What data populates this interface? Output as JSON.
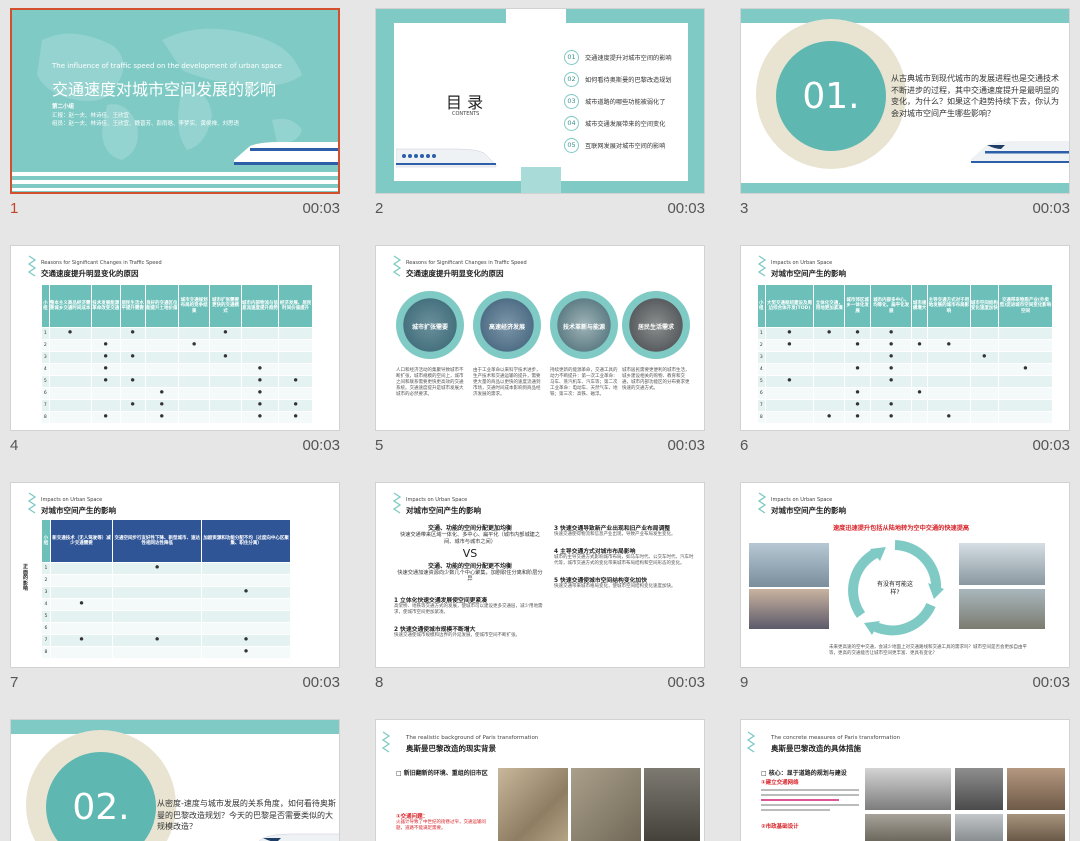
{
  "slides": [
    {
      "number": "1",
      "duration": "00:03",
      "en_title": "The influence of traffic speed on the development of urban space",
      "cn_title": "交通速度对城市空间发展的影响",
      "group": "第二小组",
      "reporters": "汇报：赵一夫、林诗佳、王欣宜",
      "members": "组员：赵一夫、林诗佳、王欣宜、魏晋芳、彭雨晗、李梦实、黄侯禅、刘思语"
    },
    {
      "number": "2",
      "duration": "00:03",
      "toc_title": "目 录",
      "toc_sub": "CONTENTS",
      "items": [
        {
          "n": "01",
          "t": "交通速度提升对城市空间的影响"
        },
        {
          "n": "02",
          "t": "如何看待奥斯曼的巴黎改造规划"
        },
        {
          "n": "03",
          "t": "城市道路的哪些功能被弱化了"
        },
        {
          "n": "04",
          "t": "城市交通发展带来的空间变化"
        },
        {
          "n": "05",
          "t": "互联网发展对城市空间的影响"
        }
      ]
    },
    {
      "number": "3",
      "duration": "00:03",
      "big": "01.",
      "text": "从古典城市到现代城市的发展进程也是交通技术不断进步的过程，其中交通速度提升是最明显的变化，为什么？如果这个趋势持续下去，你认为会对城市空间产生哪些影响？"
    },
    {
      "number": "4",
      "duration": "00:03",
      "en": "Reasons for Significant Changes in Traffic Speed",
      "cn": "交通速度提升明显变化的原因",
      "headers": [
        "小组",
        "整本主义商品经济需要城乡交通时间成本",
        "技术发展能源革命改变交通",
        "居民生活水平提升需要",
        "良好的交通区位能提升土地价值",
        "城市交通规划布局的竞争结果",
        "城市扩张需要更快的交通模式",
        "城市内部物流与信息流速度提升趋势",
        "经济发展、居民时间价值提升"
      ],
      "rows": [
        [
          "1",
          "●",
          "",
          "●",
          "",
          "",
          "●",
          "",
          ""
        ],
        [
          "2",
          "",
          "●",
          "",
          "",
          "●",
          "",
          "",
          ""
        ],
        [
          "3",
          "",
          "●",
          "●",
          "",
          "",
          "●",
          "",
          ""
        ],
        [
          "4",
          "",
          "●",
          "",
          "",
          "",
          "",
          "●",
          ""
        ],
        [
          "5",
          "",
          "●",
          "●",
          "",
          "",
          "",
          "●",
          "●"
        ],
        [
          "6",
          "",
          "",
          "",
          "●",
          "",
          "",
          "●",
          ""
        ],
        [
          "7",
          "",
          "",
          "●",
          "●",
          "",
          "",
          "●",
          "●"
        ],
        [
          "8",
          "",
          "●",
          "",
          "●",
          "",
          "",
          "●",
          "●"
        ]
      ]
    },
    {
      "number": "5",
      "duration": "00:03",
      "en": "Reasons for Significant Changes in Traffic Speed",
      "cn": "交通速度提升明显变化的原因",
      "circles": [
        "城市扩张需要",
        "高速经济发展",
        "技术革新与能源",
        "居民生活需求"
      ],
      "texts": [
        "人口和经济活动的集聚导致城市不断扩张，城市规模的空间上，城市之间和联系需要更快更高效的交通系统。交通速度提升是城市发展大城市的必然要求。",
        "由于工业革命以来科学技术进步，生产技术和交通运输的提升，需要更大量的商品以更快的速度流通到市场，交通时间成本影响到商品经济发展的需求。",
        "持续更新的能源革命，交通工具的动力不断提升：第一次工业革命：马车、蒸汽机车、汽车等；第二次工业革命：电动车、天然气车、地铁；第三次：高铁、磁浮。",
        "城市居民需要更便利的城市生活，城乡建设相关的购物、教育和交通，城市内部功能区的分布要求更快速的交通方式。"
      ]
    },
    {
      "number": "6",
      "duration": "00:03",
      "en": "Impacts on Urban Space",
      "cn": "对城市空间产生的影响",
      "headers": [
        "小组",
        "大型交通枢纽建设及周边综合体开发(TOD)",
        "立体化交通，用地更加紧凑",
        "城市郊区城乡一体化发展",
        "城市内部多中心，均等化，扁平化发展",
        "城市规模增大",
        "主导交通方式对于用地发展的城市布局影响",
        "城市空间结构变化速度加快",
        "交通带来物质产业(外卖型)促进城市空间变化影响空间"
      ],
      "rows": [
        [
          "1",
          "●",
          "●",
          "●",
          "●",
          "",
          "",
          "",
          ""
        ],
        [
          "2",
          "●",
          "",
          "●",
          "●",
          "●",
          "●",
          "",
          ""
        ],
        [
          "3",
          "",
          "",
          "",
          "●",
          "",
          "",
          "●",
          ""
        ],
        [
          "4",
          "",
          "",
          "●",
          "●",
          "",
          "",
          "",
          "●"
        ],
        [
          "5",
          "●",
          "",
          "",
          "●",
          "",
          "",
          "",
          ""
        ],
        [
          "6",
          "",
          "",
          "●",
          "",
          "●",
          "",
          "",
          ""
        ],
        [
          "7",
          "",
          "",
          "●",
          "●",
          "",
          "",
          "",
          ""
        ],
        [
          "8",
          "",
          "●",
          "●",
          "●",
          "",
          "●",
          "",
          ""
        ]
      ]
    },
    {
      "number": "7",
      "duration": "00:03",
      "en": "Impacts on Urban Space",
      "cn": "对城市空间产生的影响",
      "side": "正面的影响",
      "headers": [
        "小组",
        "新交通技术（无人驾驶等）减少交通需要",
        "交通空间步行友好性下降、新型城市、速达性相同达性降低",
        "加剧资源和功能分配不均（过度向中心区聚集、职住分离）"
      ],
      "rows": [
        [
          "1",
          "",
          "●",
          ""
        ],
        [
          "2",
          "",
          "",
          ""
        ],
        [
          "3",
          "",
          "",
          "●"
        ],
        [
          "4",
          "●",
          "",
          ""
        ],
        [
          "5",
          "",
          "",
          ""
        ],
        [
          "6",
          "",
          "",
          ""
        ],
        [
          "7",
          "●",
          "●",
          "●"
        ],
        [
          "8",
          "",
          "",
          "●"
        ]
      ]
    },
    {
      "number": "8",
      "duration": "00:03",
      "en": "Impacts on Urban Space",
      "cn": "对城市空间产生的影响",
      "box1": "交通、功能的空间分配更加均衡",
      "box1b": "快速交通带来区域一体化、多中心、扁平化（城市内部城建之间、城市与城市之间）",
      "vs": "VS",
      "box2": "交通、功能的空间分配更不均衡",
      "box2b": "快速交通加速资源向少数几个中心聚集，加剧职住分离和阶层分异",
      "l1": "1 立体化快速交通发展使空间更紧凑",
      "l1t": "高架桥、地铁等交通方式的发展，使城市可以建设更多交通层，减少用地需求，使城市空间更加紧凑。",
      "l2": "2 快速交通使城市规模不断增大",
      "l2t": "快速交通使城市规模和边界的外延发展，使城市空间不断扩张。",
      "r3": "3 快速交通导致新产业出现和旧产业布局调整",
      "r3t": "快速交通使得物流和信息产业出现，导致产业布局发生变化。",
      "r4": "4 主导交通方式对城市布局影响",
      "r4t": "城市的主导交通方式影响城市布局，如马车时代、公交车时代、汽车时代等，城市交通方式的变化带来城市布局结构和空间形态的变化。",
      "r5": "5 快速交通使城市空间结构变化加快",
      "r5t": "快速交通带来城市格局变化，使城市空间结构变化速度加快。"
    },
    {
      "number": "9",
      "duration": "00:03",
      "en": "Impacts on Urban Space",
      "cn": "对城市空间产生的影响",
      "headline": "速度迅速提升包括从陆地转为空中交通的快速提高",
      "center": "有没有可能这样?",
      "caption": "未来更高速的空中交通，会减少地面上对交通路线和交通工具的需求吗？城市空间是否会更加自由平等，更高的交通能否让城市空间更丰富、更具有变化？"
    },
    {
      "number": "10",
      "duration": "",
      "big": "02.",
      "text": "从密度-速度与城市发展的关系角度，如何看待奥斯曼的巴黎改造规划？今天的巴黎是否需要类似的大规模改造？"
    },
    {
      "number": "11",
      "duration": "",
      "en": "The realistic background of Paris transformation",
      "cn": "奥斯曼巴黎改造的现实背景",
      "b1": "□ 新旧翻新的环境、重组的旧市区",
      "b2": "①交通问题：",
      "b2t": "火器计导致了中世纪的街巷过窄，交通运输问题，道路不能满足需要。"
    },
    {
      "number": "12",
      "duration": "",
      "en": "The concrete measures of Paris transformation",
      "cn": "奥斯曼巴黎改造的具体措施",
      "b1": "□ 核心：显于道路的规划与建设",
      "b2": "①建立交通网络",
      "b3": "②市政基础设计"
    }
  ],
  "colors": {
    "teal": "#7fcac5",
    "dark_teal": "#3d9b94",
    "selected": "#d2502e",
    "red": "#d8242a"
  },
  "icons": {
    "logo": "zigzag-logo-icon",
    "train": "train-icon"
  }
}
